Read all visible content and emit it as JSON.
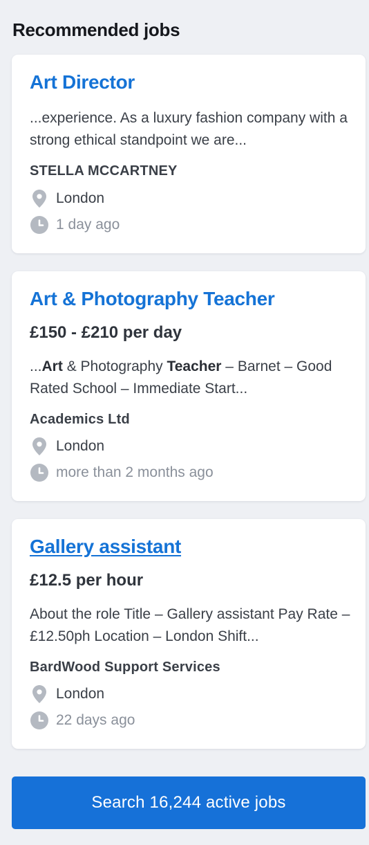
{
  "header": {
    "title": "Recommended jobs"
  },
  "jobs": [
    {
      "title": "Art Director",
      "snippet": " ...experience. As a luxury fashion company with a strong ethical standpoint we are...",
      "company": "STELLA MCCARTNEY",
      "location": "London",
      "posted": "1 day ago"
    },
    {
      "title": "Art & Photography Teacher",
      "salary": "£150 - £210 per day",
      "snippet_parts": [
        " ...",
        "Art",
        " & Photography ",
        "Teacher",
        " – Barnet – Good Rated School – Immediate Start..."
      ],
      "company": "Academics Ltd",
      "location": "London",
      "posted": "more than 2 months ago"
    },
    {
      "title": "Gallery assistant",
      "salary": "£12.5 per hour",
      "snippet": "About the role Title – Gallery assistant Pay Rate – £12.50ph Location – London Shift...",
      "company": "BardWood Support Services",
      "location": "London",
      "posted": "22 days ago"
    }
  ],
  "search_button": {
    "label": "Search 16,244 active jobs"
  },
  "icons": {
    "location": "map-pin-icon",
    "time": "clock-icon"
  },
  "colors": {
    "accent": "#1573d6",
    "button": "#1671d8",
    "background": "#eef0f4",
    "icon": "#b4b9c1"
  }
}
